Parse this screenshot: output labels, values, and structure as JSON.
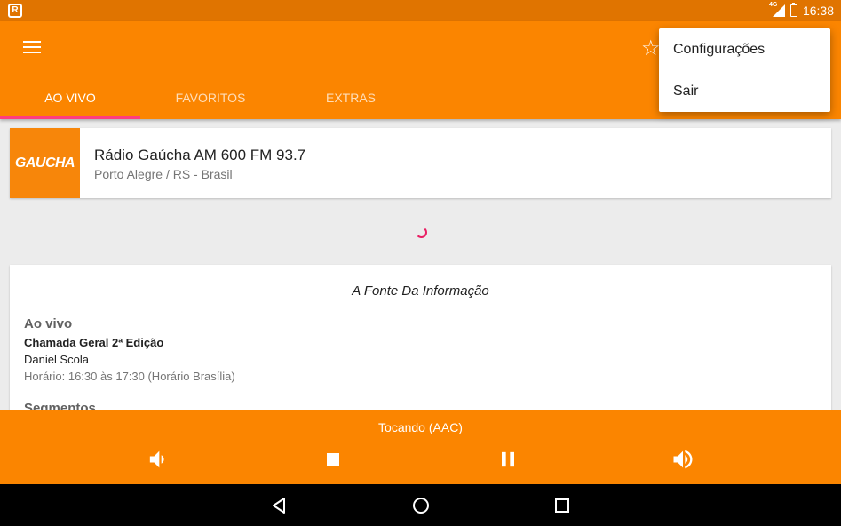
{
  "status_bar": {
    "app_icon_letter": "R",
    "network": "4G",
    "time": "16:38"
  },
  "tabs": [
    {
      "label": "AO VIVO",
      "active": true
    },
    {
      "label": "FAVORITOS",
      "active": false
    },
    {
      "label": "EXTRAS",
      "active": false
    }
  ],
  "overflow_menu": {
    "items": [
      "Configurações",
      "Sair"
    ]
  },
  "station": {
    "logo_text": "GAUCHA",
    "name": "Rádio Gaúcha AM 600 FM 93.7",
    "location": "Porto Alegre / RS - Brasil"
  },
  "info": {
    "slogan": "A Fonte Da Informação",
    "live_title": "Ao vivo",
    "program": "Chamada Geral 2ª Edição",
    "host": "Daniel Scola",
    "schedule": "Horário: 16:30 às 17:30  (Horário Brasília)",
    "segments_title": "Segmentos"
  },
  "player": {
    "status": "Tocando (AAC)"
  },
  "icons": {
    "menu": "hamburger-icon",
    "favorite": "star-outline-icon",
    "volume_down": "volume-down-icon",
    "stop": "stop-icon",
    "pause": "pause-icon",
    "volume_up": "volume-up-icon",
    "back": "back-triangle-icon",
    "home": "home-circle-icon",
    "recents": "recents-square-icon"
  },
  "colors": {
    "primary": "#fb8500",
    "status_bar": "#e07400",
    "tab_indicator": "#ff3d7f"
  }
}
